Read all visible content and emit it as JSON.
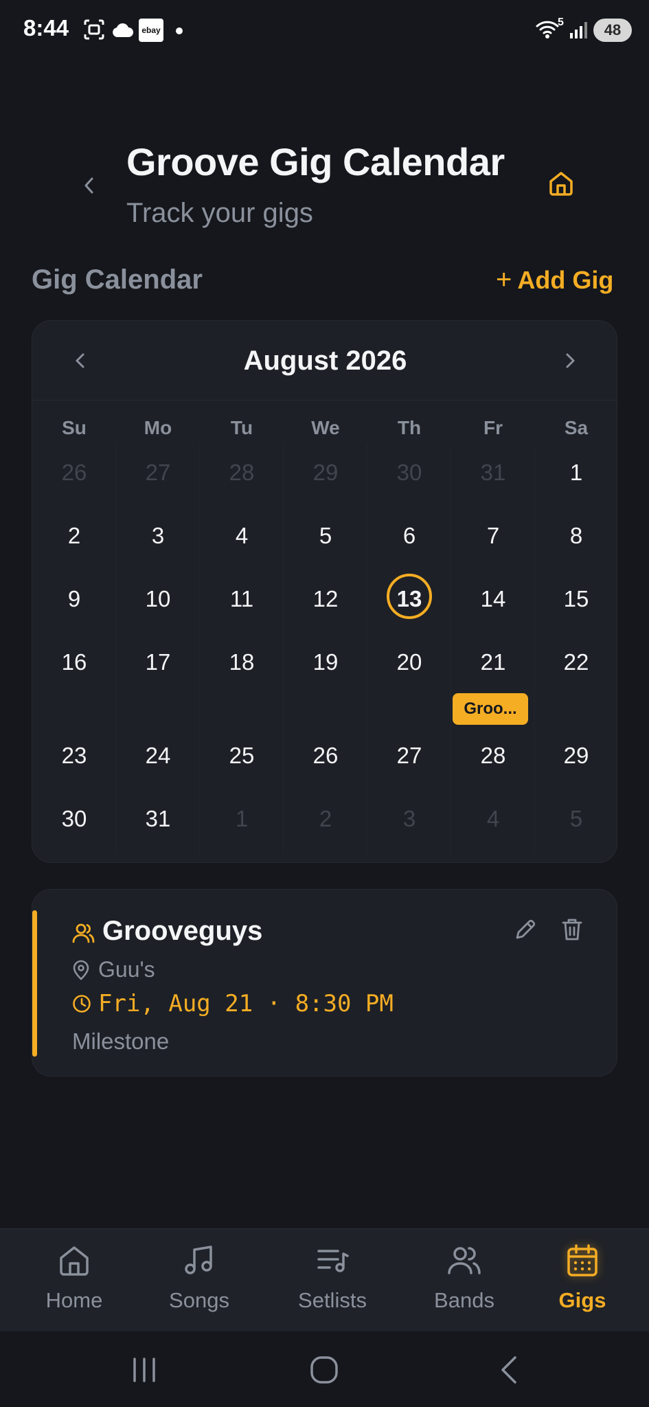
{
  "status_bar": {
    "time": "8:44",
    "ebay_label": "ebay",
    "wifi_label": "5",
    "battery": "48"
  },
  "header": {
    "title": "Groove Gig Calendar",
    "subtitle": "Track your gigs"
  },
  "section": {
    "title": "Gig Calendar",
    "add_label": "Add Gig",
    "add_symbol": "+"
  },
  "calendar": {
    "month_label": "August 2026",
    "weekdays": [
      "Su",
      "Mo",
      "Tu",
      "We",
      "Th",
      "Fr",
      "Sa"
    ],
    "weeks": [
      [
        {
          "d": "26",
          "m": true
        },
        {
          "d": "27",
          "m": true
        },
        {
          "d": "28",
          "m": true
        },
        {
          "d": "29",
          "m": true
        },
        {
          "d": "30",
          "m": true
        },
        {
          "d": "31",
          "m": true
        },
        {
          "d": "1"
        }
      ],
      [
        {
          "d": "2"
        },
        {
          "d": "3"
        },
        {
          "d": "4"
        },
        {
          "d": "5"
        },
        {
          "d": "6"
        },
        {
          "d": "7"
        },
        {
          "d": "8"
        }
      ],
      [
        {
          "d": "9"
        },
        {
          "d": "10"
        },
        {
          "d": "11"
        },
        {
          "d": "12"
        },
        {
          "d": "13",
          "today": true
        },
        {
          "d": "14"
        },
        {
          "d": "15"
        }
      ],
      [
        {
          "d": "16"
        },
        {
          "d": "17"
        },
        {
          "d": "18"
        },
        {
          "d": "19"
        },
        {
          "d": "20"
        },
        {
          "d": "21"
        },
        {
          "d": "22"
        }
      ],
      [
        {
          "d": "23"
        },
        {
          "d": "24"
        },
        {
          "d": "25"
        },
        {
          "d": "26"
        },
        {
          "d": "27"
        },
        {
          "d": "28"
        },
        {
          "d": "29"
        }
      ],
      [
        {
          "d": "30"
        },
        {
          "d": "31"
        },
        {
          "d": "1",
          "m": true
        },
        {
          "d": "2",
          "m": true
        },
        {
          "d": "3",
          "m": true
        },
        {
          "d": "4",
          "m": true
        },
        {
          "d": "5",
          "m": true
        }
      ]
    ],
    "event_chip": "Groo..."
  },
  "gig": {
    "band": "Grooveguys",
    "venue": "Guu's",
    "datetime": "Fri, Aug 21 · 8:30 PM",
    "notes": "Milestone"
  },
  "nav": {
    "home": "Home",
    "songs": "Songs",
    "setlists": "Setlists",
    "bands": "Bands",
    "gigs": "Gigs"
  },
  "colors": {
    "accent": "#f5ad24",
    "background": "#15171c",
    "card": "#1d2026",
    "muted_text": "#8b919c"
  }
}
